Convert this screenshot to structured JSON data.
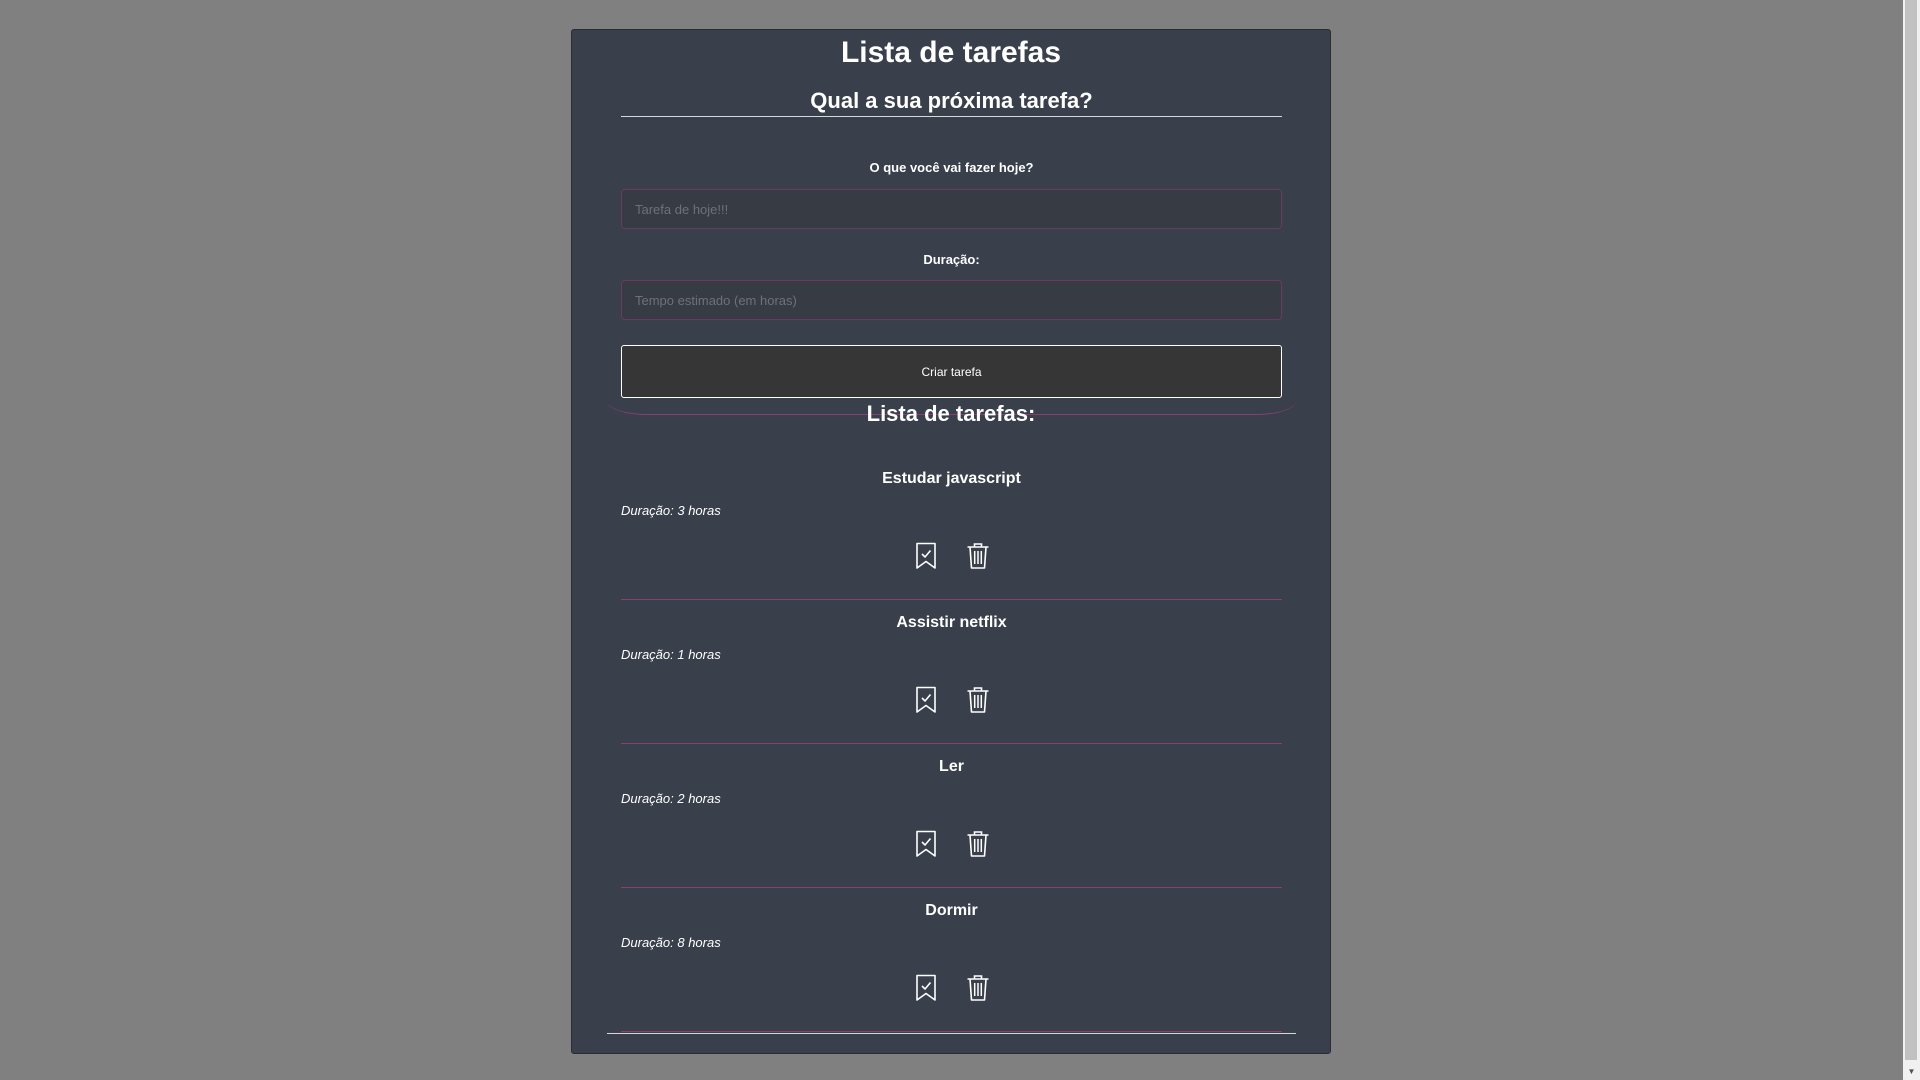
{
  "header": {
    "title": "Lista de tarefas"
  },
  "form": {
    "subtitle": "Qual a sua próxima tarefa?",
    "task_label": "O que você vai fazer hoje?",
    "task_placeholder": "Tarefa de hoje!!!",
    "duration_label": "Duração:",
    "duration_placeholder": "Tempo estimado (em horas)",
    "create_button": "Criar tarefa"
  },
  "list": {
    "title": "Lista de tarefas:",
    "tasks": [
      {
        "name": "Estudar javascript",
        "duration": "Duração: 3 horas"
      },
      {
        "name": "Assistir netflix",
        "duration": "Duração: 1 horas"
      },
      {
        "name": "Ler",
        "duration": "Duração: 2 horas"
      },
      {
        "name": "Dormir",
        "duration": "Duração: 8 horas"
      }
    ],
    "icons": {
      "complete": "bookmark-check-icon",
      "delete": "trash-icon"
    }
  },
  "colors": {
    "page_background": "#808080",
    "card_background": "#393f4b",
    "accent_line": "#8a3f72",
    "button_background": "#363636",
    "text": "#ffffff"
  }
}
